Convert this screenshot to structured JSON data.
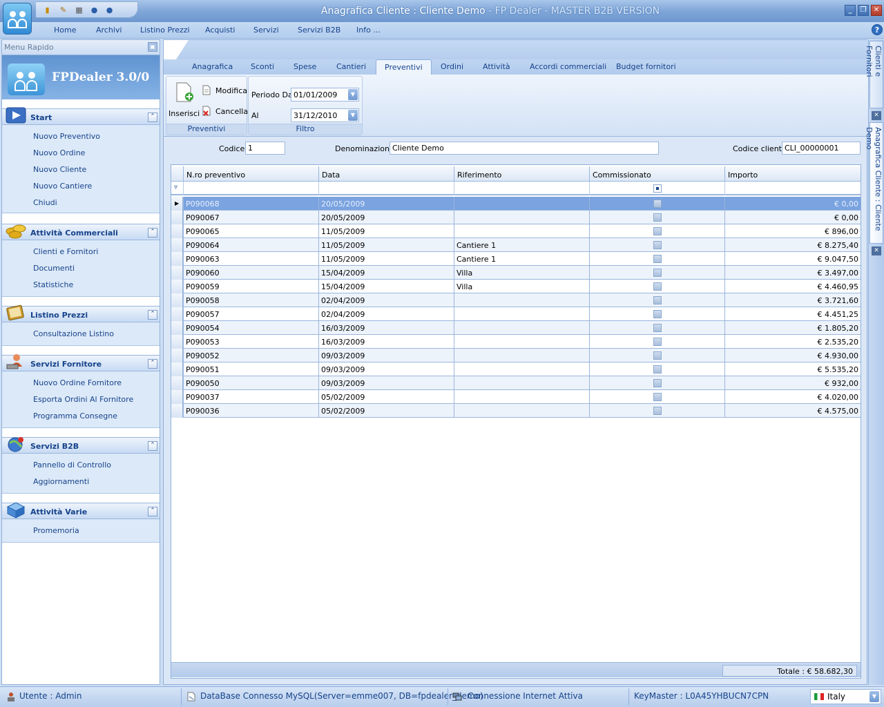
{
  "window": {
    "title_main": "Anagrafica Cliente : Cliente Demo",
    "title_sub": " - FP Dealer - MASTER B2B VERSION"
  },
  "menu": [
    "Home",
    "Archivi",
    "Listino Prezzi",
    "Acquisti",
    "Servizi",
    "Servizi B2B",
    "Info ..."
  ],
  "sidebar": {
    "header": "Menu Rapido",
    "version": "FPDealer 3.0/0",
    "groups": [
      {
        "title": "Start",
        "icon": "play-icon",
        "items": [
          "Nuovo Preventivo",
          "Nuovo Ordine",
          "Nuovo Cliente",
          "Nuovo Cantiere",
          "Chiudi"
        ]
      },
      {
        "title": "Attività Commerciali",
        "icon": "coins-icon",
        "items": [
          "Clienti e Fornitori",
          "Documenti",
          "Statistiche"
        ]
      },
      {
        "title": "Listino Prezzi",
        "icon": "book-icon",
        "items": [
          "Consultazione Listino"
        ]
      },
      {
        "title": "Servizi Fornitore",
        "icon": "supplier-icon",
        "items": [
          "Nuovo Ordine Fornitore",
          "Esporta Ordini Al Fornitore",
          "Programma Consegne"
        ]
      },
      {
        "title": "Servizi B2B",
        "icon": "globe-icon",
        "items": [
          "Pannello di Controllo",
          "Aggiornamenti"
        ]
      },
      {
        "title": "Attività Varie",
        "icon": "box-icon",
        "items": [
          "Promemoria"
        ]
      }
    ]
  },
  "tabs": [
    "Anagrafica",
    "Sconti",
    "Spese",
    "Cantieri",
    "Preventivi",
    "Ordini",
    "Attività",
    "Accordi commerciali",
    "Budget fornitori"
  ],
  "active_tab": "Preventivi",
  "ribbon": {
    "insert_label": "Inserisci",
    "edit_label": "Modifica",
    "delete_label": "Cancella",
    "group_preventivi": "Preventivi",
    "period_from_label": "Periodo Dal",
    "period_from": "01/01/2009",
    "period_to_label": "Al",
    "period_to": "31/12/2010",
    "group_filtro": "Filtro"
  },
  "customer": {
    "codice_label": "Codice",
    "codice": "1",
    "denominazione_label": "Denominazione",
    "denominazione": "Cliente Demo",
    "codice_cliente_label": "Codice cliente",
    "codice_cliente": "CLI_00000001"
  },
  "grid": {
    "columns": [
      "N.ro preventivo",
      "Data",
      "Riferimento",
      "Commissionato",
      "Importo"
    ],
    "rows": [
      {
        "num": "P090068",
        "data": "20/05/2009",
        "rif": "",
        "imp": "€ 0,00",
        "selected": true
      },
      {
        "num": "P090067",
        "data": "20/05/2009",
        "rif": "",
        "imp": "€ 0,00"
      },
      {
        "num": "P090065",
        "data": "11/05/2009",
        "rif": "",
        "imp": "€ 896,00"
      },
      {
        "num": "P090064",
        "data": "11/05/2009",
        "rif": "Cantiere 1",
        "imp": "€ 8.275,40"
      },
      {
        "num": "P090063",
        "data": "11/05/2009",
        "rif": "Cantiere 1",
        "imp": "€ 9.047,50"
      },
      {
        "num": "P090060",
        "data": "15/04/2009",
        "rif": "Villa",
        "imp": "€ 3.497,00"
      },
      {
        "num": "P090059",
        "data": "15/04/2009",
        "rif": "Villa",
        "imp": "€ 4.460,95"
      },
      {
        "num": "P090058",
        "data": "02/04/2009",
        "rif": "",
        "imp": "€ 3.721,60"
      },
      {
        "num": "P090057",
        "data": "02/04/2009",
        "rif": "",
        "imp": "€ 4.451,25"
      },
      {
        "num": "P090054",
        "data": "16/03/2009",
        "rif": "",
        "imp": "€ 1.805,20"
      },
      {
        "num": "P090053",
        "data": "16/03/2009",
        "rif": "",
        "imp": "€ 2.535,20"
      },
      {
        "num": "P090052",
        "data": "09/03/2009",
        "rif": "",
        "imp": "€ 4.930,00"
      },
      {
        "num": "P090051",
        "data": "09/03/2009",
        "rif": "",
        "imp": "€ 5.535,20"
      },
      {
        "num": "P090050",
        "data": "09/03/2009",
        "rif": "",
        "imp": "€ 932,00"
      },
      {
        "num": "P090037",
        "data": "05/02/2009",
        "rif": "",
        "imp": "€ 4.020,00"
      },
      {
        "num": "P090036",
        "data": "05/02/2009",
        "rif": "",
        "imp": "€ 4.575,00"
      }
    ],
    "total": "Totale  : € 58.682,30"
  },
  "rail": {
    "tab1": "Clienti e Fornitori",
    "tab2": "Anagrafica Cliente : Cliente Demo"
  },
  "status": {
    "user": "Utente : Admin",
    "db": "DataBase Connesso MySQL(Server=emme007, DB=fpdealer_demo)",
    "internet": "Connessione Internet Attiva",
    "key": "KeyMaster : L0A45YHBUCN7CPN",
    "language": "Italy"
  }
}
